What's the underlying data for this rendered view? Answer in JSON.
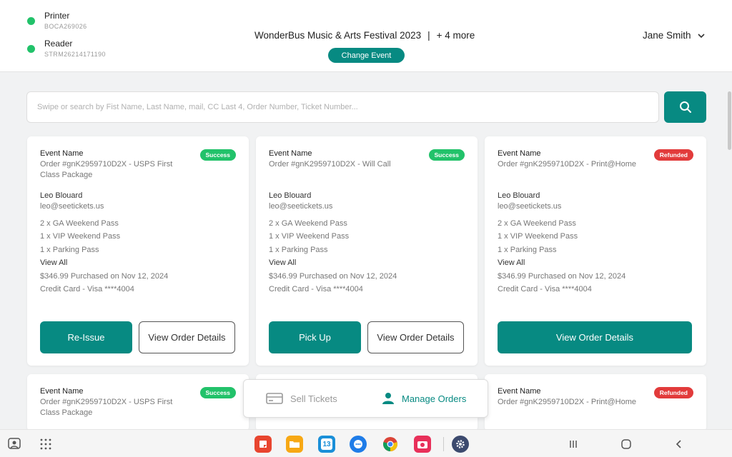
{
  "header": {
    "devices": [
      {
        "name": "Printer",
        "id": "BOCA269026"
      },
      {
        "name": "Reader",
        "id": "STRM26214171190"
      }
    ],
    "event_title": "WonderBus Music & Arts Festival 2023",
    "more_events": "+ 4 more",
    "change_event_label": "Change Event",
    "user_name": "Jane Smith"
  },
  "search": {
    "placeholder": "Swipe or search by Fist Name, Last Name, mail, CC Last 4, Order Number, Ticket Number..."
  },
  "cards": [
    {
      "event_label": "Event Name",
      "status": "Success",
      "order": "Order #gnK2959710D2X - USPS First Class Package",
      "customer_name": "Leo Blouard",
      "customer_email": "leo@seetickets.us",
      "items": [
        "2 x GA Weekend Pass",
        "1 x VIP Weekend Pass",
        "1 x Parking Pass"
      ],
      "view_all": "View All",
      "purchase": "$346.99 Purchased on Nov 12, 2024",
      "payment": "Credit Card - Visa ****4004",
      "primary_action": "Re-Issue",
      "secondary_action": "View Order Details"
    },
    {
      "event_label": "Event Name",
      "status": "Success",
      "order": "Order #gnK2959710D2X - Will Call",
      "customer_name": "Leo Blouard",
      "customer_email": "leo@seetickets.us",
      "items": [
        "2 x GA Weekend Pass",
        "1 x VIP Weekend Pass",
        "1 x Parking Pass"
      ],
      "view_all": "View All",
      "purchase": "$346.99 Purchased on Nov 12, 2024",
      "payment": "Credit Card - Visa ****4004",
      "primary_action": "Pick Up",
      "secondary_action": "View Order Details"
    },
    {
      "event_label": "Event Name",
      "status": "Refunded",
      "order": "Order #gnK2959710D2X - Print@Home",
      "customer_name": "Leo Blouard",
      "customer_email": "leo@seetickets.us",
      "items": [
        "2 x GA Weekend Pass",
        "1 x VIP Weekend Pass",
        "1 x Parking Pass"
      ],
      "view_all": "View All",
      "purchase": "$346.99 Purchased on Nov 12, 2024",
      "payment": "Credit Card - Visa ****4004",
      "primary_action": "View Order Details"
    },
    {
      "event_label": "Event Name",
      "status": "Success",
      "order": "Order #gnK2959710D2X - USPS First Class Package"
    },
    {
      "event_label": "Event Name",
      "status": "Refunded",
      "order": "Order #gnK2959710D2X - Print@Home"
    }
  ],
  "tabbar": {
    "sell_label": "Sell Tickets",
    "manage_label": "Manage Orders"
  },
  "system_nav": {
    "calendar_date": "13",
    "apps": [
      "notes-app-icon",
      "files-app-icon",
      "calendar-app-icon",
      "messages-app-icon",
      "chrome-icon",
      "camera-app-icon",
      "settings-app-icon"
    ]
  },
  "colors": {
    "accent": "#078a82",
    "success": "#22c26a",
    "refunded": "#e23b3b",
    "background": "#f1f2f3"
  }
}
